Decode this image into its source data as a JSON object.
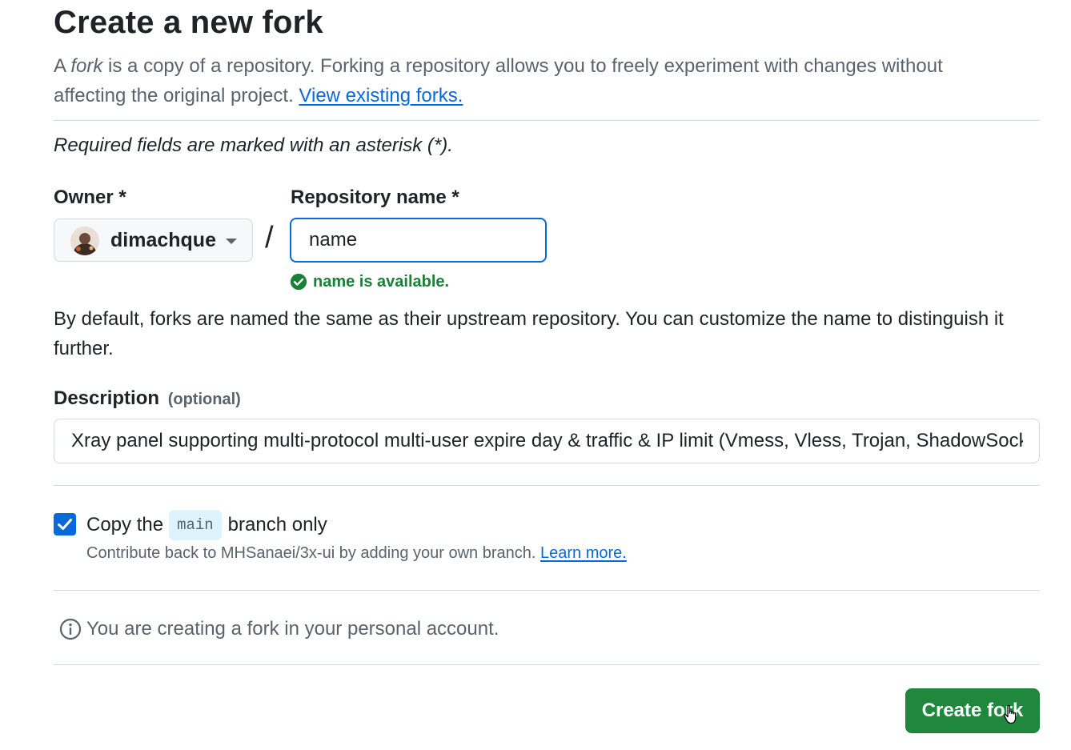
{
  "page": {
    "title": "Create a new fork",
    "intro_prefix": "A",
    "intro_fork_word": "fork",
    "intro_rest": "is a copy of a repository. Forking a repository allows you to freely experiment with changes without affecting the original project.",
    "view_forks_link": "View existing forks."
  },
  "form": {
    "required_note": "Required fields are marked with an asterisk (*).",
    "owner_label": "Owner *",
    "owner_value": "dimachque",
    "owner_avatar_icon": "user-avatar",
    "separator": "/",
    "repo_label": "Repository name *",
    "repo_value": "name",
    "availability_icon": "check-circle-fill-icon",
    "availability_message": "name is available.",
    "help_text": "By default, forks are named the same as their upstream repository. You can customize the name to distinguish it further.",
    "description_label": "Description",
    "description_optional": "(optional)",
    "description_value": "Xray panel supporting multi-protocol multi-user expire day & traffic & IP limit (Vmess, Vless, Trojan, ShadowSocks, Wireguard)"
  },
  "copy_branch": {
    "checked": true,
    "label_before": "Copy the",
    "branch": "main",
    "label_after": "branch only",
    "sub_text": "Contribute back to MHSanaei/3x-ui by adding your own branch.",
    "learn_more": "Learn more."
  },
  "notice": {
    "icon": "info-icon",
    "text": "You are creating a fork in your personal account."
  },
  "actions": {
    "create_label": "Create fork"
  },
  "colors": {
    "primary_button": "#1f883d",
    "link": "#0969da",
    "success": "#1a7f37",
    "focus_border": "#0969da",
    "muted_text": "#59636e"
  }
}
